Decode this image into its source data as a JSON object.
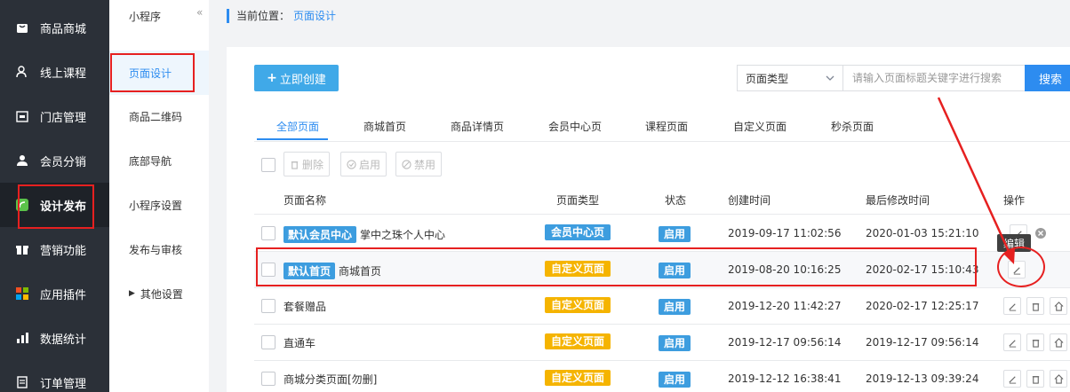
{
  "sidebar": {
    "items": [
      {
        "label": "商品商城",
        "icon": "shopping-bag-icon"
      },
      {
        "label": "线上课程",
        "icon": "user-course-icon"
      },
      {
        "label": "门店管理",
        "icon": "store-icon"
      },
      {
        "label": "会员分销",
        "icon": "member-icon"
      },
      {
        "label": "设计发布",
        "icon": "design-publish-icon"
      },
      {
        "label": "营销功能",
        "icon": "gift-icon"
      },
      {
        "label": "应用插件",
        "icon": "apps-grid-icon"
      },
      {
        "label": "数据统计",
        "icon": "bar-chart-icon"
      },
      {
        "label": "订单管理",
        "icon": "order-icon"
      }
    ],
    "active_index": 4
  },
  "submenu": {
    "title": "小程序",
    "collapse_glyph": "«",
    "items": [
      "页面设计",
      "商品二维码",
      "底部导航",
      "小程序设置",
      "发布与审核",
      "其他设置"
    ]
  },
  "breadcrumb": {
    "prefix": "当前位置：",
    "current": "页面设计"
  },
  "toolbar": {
    "create_label": "立即创建",
    "type_select_value": "页面类型",
    "search_placeholder": "请输入页面标题关键字进行搜索",
    "search_label": "搜索"
  },
  "tabs": [
    "全部页面",
    "商城首页",
    "商品详情页",
    "会员中心页",
    "课程页面",
    "自定义页面",
    "秒杀页面"
  ],
  "bulk": {
    "delete": "删除",
    "enable": "启用",
    "disable": "禁用"
  },
  "table": {
    "headers": [
      "页面名称",
      "页面类型",
      "状态",
      "创建时间",
      "最后修改时间",
      "操作"
    ],
    "rows": [
      {
        "tag": "默认会员中心",
        "name": "掌中之珠个人中心",
        "type": "会员中心页",
        "type_color": "blue",
        "status": "启用",
        "created": "2019-09-17 11:02:56",
        "modified": "2020-01-03 15:21:10"
      },
      {
        "tag": "默认首页",
        "name": "商城首页",
        "type": "自定义页面",
        "type_color": "yellow",
        "status": "启用",
        "created": "2019-08-20 10:16:25",
        "modified": "2020-02-17 15:10:43"
      },
      {
        "tag": "",
        "name": "套餐赠品",
        "type": "自定义页面",
        "type_color": "yellow",
        "status": "启用",
        "created": "2019-12-20 11:42:27",
        "modified": "2020-02-17 12:25:17"
      },
      {
        "tag": "",
        "name": "直通车",
        "type": "自定义页面",
        "type_color": "yellow",
        "status": "启用",
        "created": "2019-12-17 09:56:14",
        "modified": "2019-12-17 09:56:14"
      },
      {
        "tag": "",
        "name": "商城分类页面[勿删]",
        "type": "自定义页面",
        "type_color": "yellow",
        "status": "启用",
        "created": "2019-12-12 16:38:41",
        "modified": "2019-12-13 09:39:24"
      }
    ]
  },
  "tooltip": "编辑",
  "colors": {
    "sidebar_bg": "#2b3038",
    "primary": "#2d8cf0",
    "tag_blue": "#3d9ddf",
    "tag_yellow": "#f5b400",
    "annotation_red": "#e62020"
  }
}
